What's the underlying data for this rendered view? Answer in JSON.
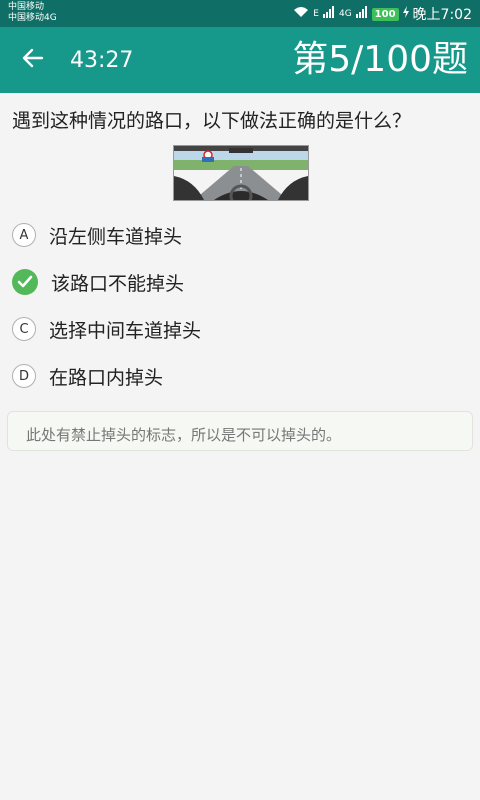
{
  "status_bar": {
    "carrier1": "中国移动",
    "carrier2": "中国移动4G",
    "signal_label_1": "E",
    "signal_label_2": "4G",
    "battery": "100",
    "time": "晚上7:02"
  },
  "toolbar": {
    "timer": "43:27",
    "progress": "第5/100题"
  },
  "question": {
    "text": "遇到这种情况的路口，以下做法正确的是什么？"
  },
  "options": [
    {
      "letter": "A",
      "text": "沿左侧车道掉头",
      "correct": false
    },
    {
      "letter": "B",
      "text": "该路口不能掉头",
      "correct": true
    },
    {
      "letter": "C",
      "text": "选择中间车道掉头",
      "correct": false
    },
    {
      "letter": "D",
      "text": "在路口内掉头",
      "correct": false
    }
  ],
  "explanation": "此处有禁止掉头的标志，所以是不可以掉头的。",
  "colors": {
    "status_bar": "#0f6f66",
    "toolbar": "#16988a",
    "correct": "#52b85a"
  }
}
